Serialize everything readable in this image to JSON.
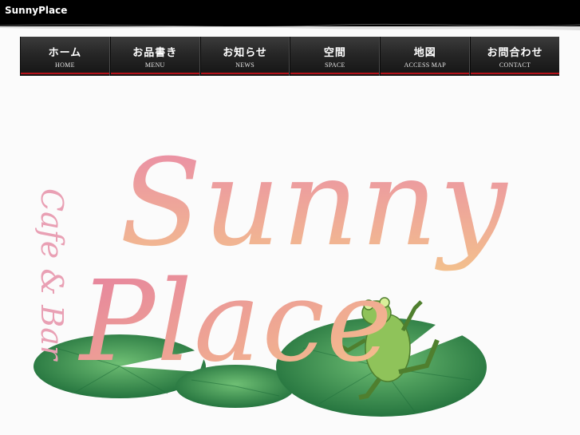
{
  "header": {
    "site_name": "SunnyPlace"
  },
  "nav": {
    "items": [
      {
        "jp": "ホーム",
        "en": "HOME"
      },
      {
        "jp": "お品書き",
        "en": "MENU"
      },
      {
        "jp": "お知らせ",
        "en": "NEWS"
      },
      {
        "jp": "空間",
        "en": "SPACE"
      },
      {
        "jp": "地図",
        "en": "ACCESS MAP"
      },
      {
        "jp": "お問合わせ",
        "en": "CONTACT"
      }
    ]
  },
  "hero": {
    "logo_text_main": "Sunny",
    "logo_text_second": "Place",
    "logo_subtitle": "Cafe & Bar",
    "colors": {
      "pink": "#e98aa8",
      "peach": "#f2b48a",
      "leaf": "#2f8f4f",
      "frog": "#8fc35a"
    }
  }
}
